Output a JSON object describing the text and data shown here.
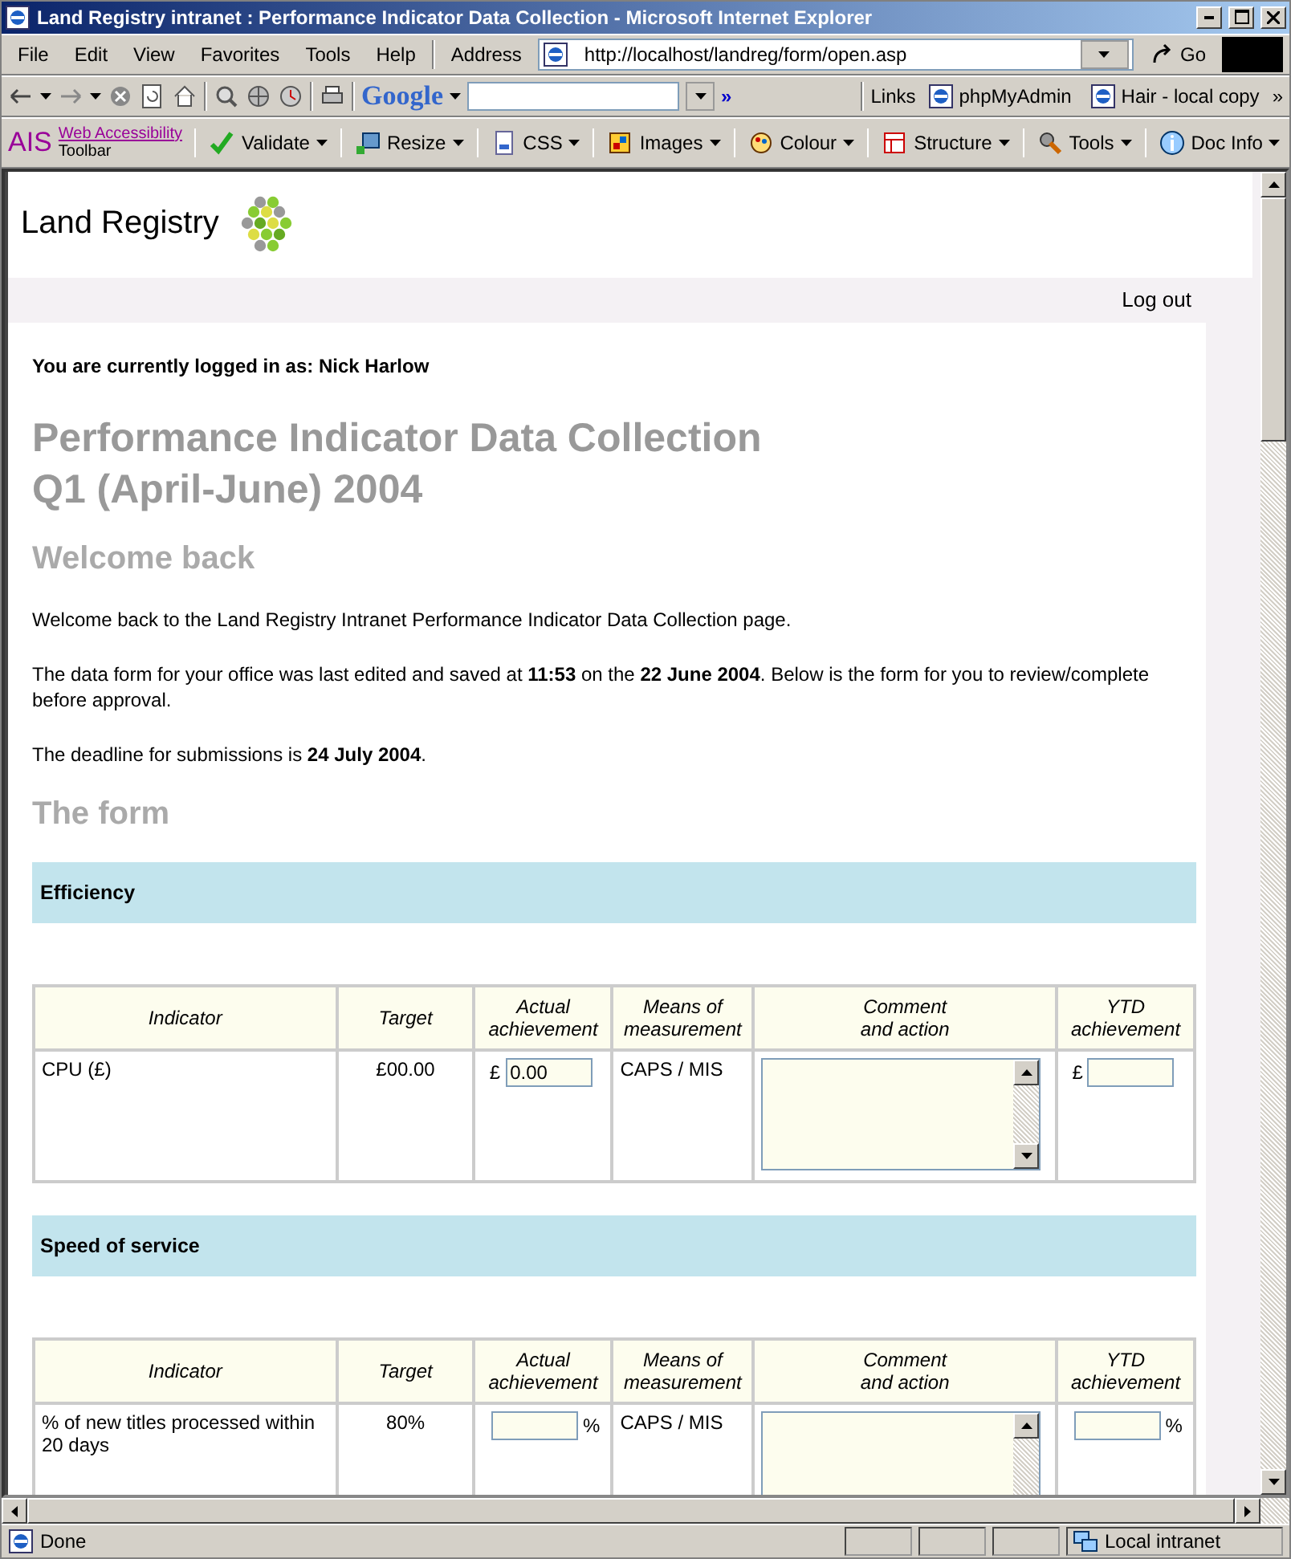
{
  "window": {
    "title": "Land Registry intranet : Performance Indicator Data Collection - Microsoft Internet Explorer"
  },
  "menu": [
    "File",
    "Edit",
    "View",
    "Favorites",
    "Tools",
    "Help"
  ],
  "address": {
    "label": "Address",
    "value": "http://localhost/landreg/form/open.asp",
    "go": "Go"
  },
  "google": {
    "label": "Google",
    "more": "»"
  },
  "links": {
    "label": "Links",
    "items": [
      "phpMyAdmin",
      "Hair - local copy"
    ],
    "more": "»"
  },
  "ais_toolbar": {
    "logo": "AIS",
    "title_line1": "Web Accessibility",
    "title_line2": "Toolbar",
    "items": [
      "Validate",
      "Resize",
      "CSS",
      "Images",
      "Colour",
      "Structure",
      "Tools",
      "Doc Info"
    ]
  },
  "page": {
    "site_name": "Land Registry",
    "logout": "Log out",
    "logged_in": "You are currently logged in as: Nick Harlow",
    "title_lines": [
      "Performance Indicator Data Collection",
      "Q1 (April-June) 2004"
    ],
    "welcome_heading": "Welcome back",
    "paragraphs": [
      "Welcome back to the Land Registry Intranet Performance Indicator Data Collection page.",
      "The data form for your office was last edited and saved at **11:53** on the **22 June 2004**. Below is the form for you to review/complete before approval.",
      "The deadline for submissions is **24 July 2004**."
    ],
    "form_heading": "The form",
    "sections": [
      {
        "title": "Efficiency",
        "columns": [
          "Indicator",
          "Target",
          "Actual achievement",
          "Means of measurement",
          "Comment and action",
          "YTD achievement"
        ],
        "rows": [
          {
            "indicator": "CPU (£)",
            "target": "£00.00",
            "actual": {
              "prefix": "£",
              "value": "0.00"
            },
            "means": "CAPS / MIS",
            "ytd": {
              "prefix": "£"
            }
          }
        ]
      },
      {
        "title": "Speed of service",
        "columns": [
          "Indicator",
          "Target",
          "Actual achievement",
          "Means of measurement",
          "Comment and action",
          "YTD achievement"
        ],
        "rows": [
          {
            "indicator": "% of new titles processed within 20 days",
            "target": "80%",
            "actual": {
              "suffix": "%"
            },
            "means": "CAPS / MIS",
            "ytd": {
              "suffix": "%"
            }
          }
        ]
      }
    ]
  },
  "status_bar": {
    "text": "Done",
    "zone": "Local intranet"
  }
}
